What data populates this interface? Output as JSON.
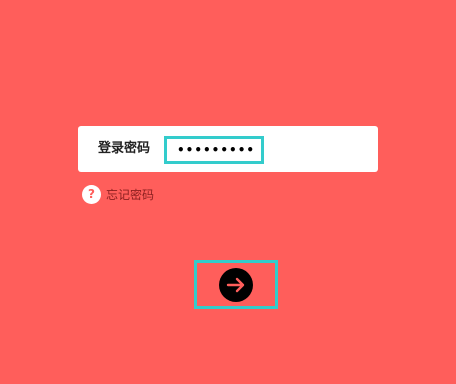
{
  "login": {
    "password_label": "登录密码",
    "password_value": "•••••••••"
  },
  "forgot": {
    "icon_glyph": "?",
    "label": "忘记密码"
  },
  "submit": {
    "icon": "arrow-right-icon"
  },
  "colors": {
    "background": "#ff5e5b",
    "highlight": "#33cccc",
    "button": "#000000",
    "box": "#ffffff"
  }
}
